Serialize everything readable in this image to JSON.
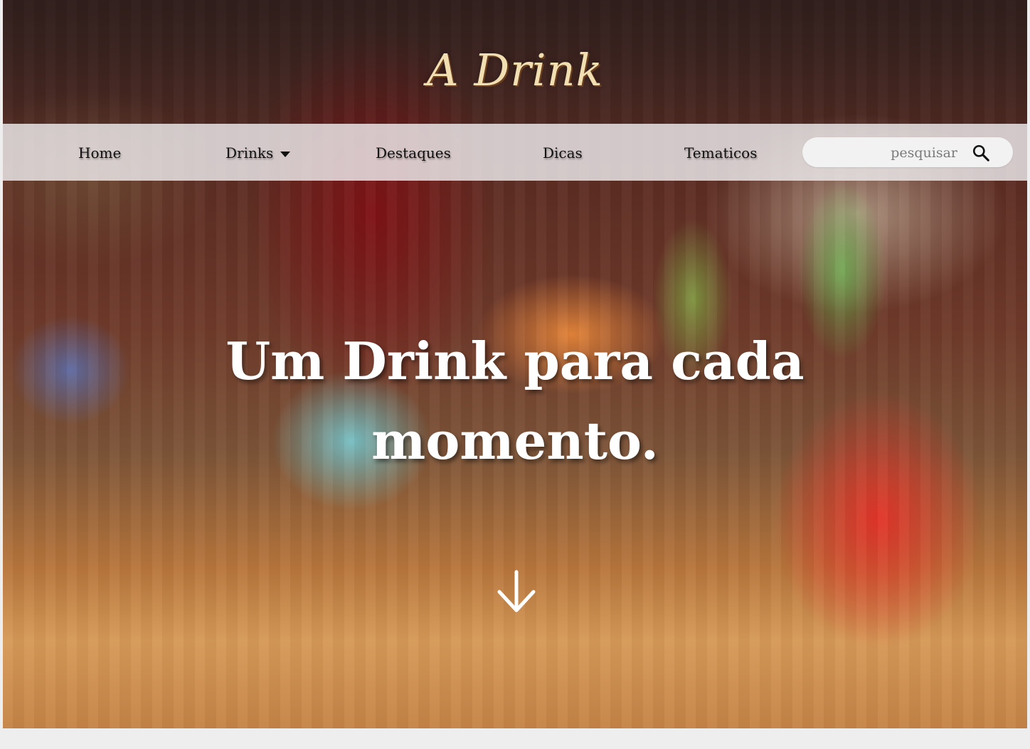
{
  "brand": {
    "logo_text": "A Drink"
  },
  "nav": {
    "items": [
      {
        "label": "Home"
      },
      {
        "label": "Drinks"
      },
      {
        "label": "Destaques"
      },
      {
        "label": "Dicas"
      },
      {
        "label": "Tematicos"
      }
    ],
    "search": {
      "placeholder": "pesquisar",
      "icon": "search-icon"
    }
  },
  "hero": {
    "headline": "Um Drink para cada momento.",
    "scroll_icon": "arrow-down-icon"
  },
  "colors": {
    "logo": "#f1dfb2",
    "nav_bg": "#eeecee",
    "headline": "#ffffff"
  }
}
